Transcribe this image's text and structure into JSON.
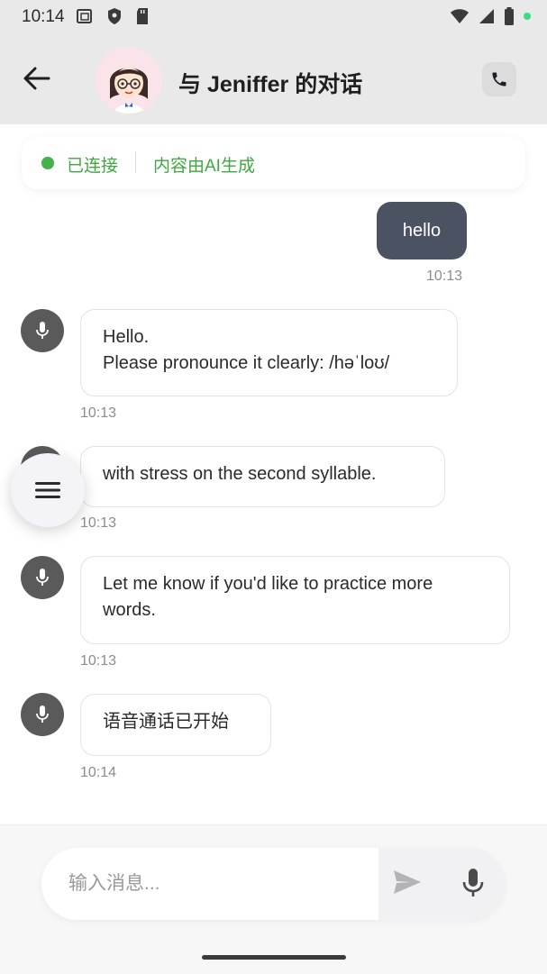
{
  "status_bar": {
    "time": "10:14",
    "left_icons": [
      "screenshot-icon",
      "shield-icon",
      "sd-card-icon"
    ],
    "right_icons": [
      "wifi-icon",
      "signal-icon",
      "battery-icon"
    ],
    "indicator_color": "#3ddc84"
  },
  "header": {
    "title": "与 Jeniffer 的对话",
    "back_icon": "arrow-left-icon",
    "avatar_icon": "cartoon-girl-avatar",
    "call_icon": "phone-icon"
  },
  "banner": {
    "connected": "已连接",
    "ai_note": "内容由AI生成",
    "accent_color": "#3ea73f"
  },
  "messages": [
    {
      "role": "user",
      "text": "hello",
      "time": "10:13"
    },
    {
      "role": "bot",
      "lines": [
        "Hello.",
        "Please pronounce it clearly: /həˈloʊ/"
      ],
      "time": "10:13"
    },
    {
      "role": "bot",
      "lines": [
        "with stress on the second syllable."
      ],
      "time": "10:13"
    },
    {
      "role": "bot",
      "lines": [
        "Let me know if you'd like to practice more",
        "words."
      ],
      "time": "10:13"
    },
    {
      "role": "bot",
      "lines": [
        "语音通话已开始"
      ],
      "time": "10:14"
    }
  ],
  "fab": {
    "icon": "menu-icon"
  },
  "composer": {
    "placeholder": "输入消息...",
    "send_icon": "send-icon",
    "mic_icon": "mic-icon"
  },
  "colors": {
    "user_bubble": "#4b5363",
    "header_bg": "#e9e9ea"
  }
}
